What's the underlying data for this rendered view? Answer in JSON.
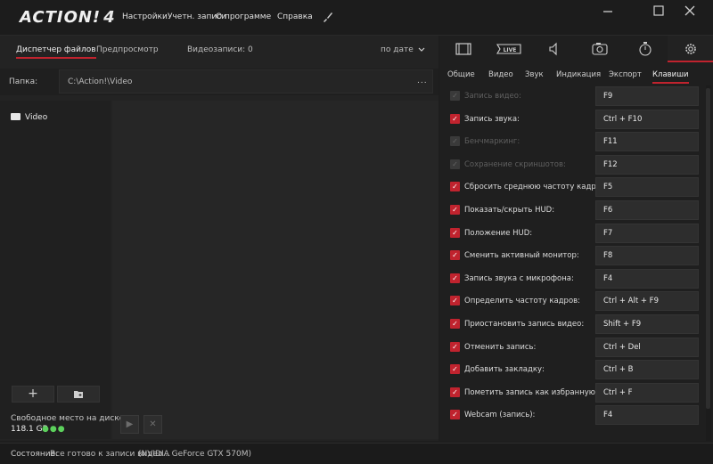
{
  "app": {
    "logo": "ACTION!",
    "logo_version": "4",
    "menu": [
      "Настройки",
      "Учетн. записи",
      "О программе",
      "Справка"
    ],
    "window_controls": [
      "minimize-icon",
      "maximize-icon",
      "close-icon"
    ]
  },
  "left": {
    "tabs": [
      "Диспетчер файлов",
      "Предпросмотр"
    ],
    "recordings_label": "Видеозаписи: 0",
    "sort_label": "по дате",
    "folder_label": "Папка:",
    "folder_path": "C:\\Action!\\Video",
    "folder_more": "...",
    "tree": [
      {
        "label": "Video"
      }
    ],
    "free_space_label": "Свободное место на диске",
    "free_space_value": "118.1 GB",
    "free_space_indicator": "●●●"
  },
  "status": {
    "label": "Состояние:",
    "text": "Все готово к записи видео...",
    "gpu": "(NVIDIA GeForce GTX 570M)"
  },
  "right": {
    "top_tabs": [
      "video-icon",
      "live-icon",
      "speaker-icon",
      "camera-icon",
      "stopwatch-icon",
      "gear-icon"
    ],
    "live_label": "LIVE",
    "sub_tabs": [
      "Общие",
      "Видео",
      "Звук",
      "Индикация",
      "Экспорт",
      "Клавиши"
    ],
    "active_sub_tab": "Клавиши",
    "hotkeys": [
      {
        "label": "Запись видео:",
        "key": "F9",
        "enabled": false
      },
      {
        "label": "Запись звука:",
        "key": "Ctrl + F10",
        "enabled": true
      },
      {
        "label": "Бенчмаркинг:",
        "key": "F11",
        "enabled": false
      },
      {
        "label": "Сохранение скриншотов:",
        "key": "F12",
        "enabled": false
      },
      {
        "label": "Сбросить среднюю частоту кадров:",
        "key": "F5",
        "enabled": true
      },
      {
        "label": "Показать/скрыть HUD:",
        "key": "F6",
        "enabled": true
      },
      {
        "label": "Положение HUD:",
        "key": "F7",
        "enabled": true
      },
      {
        "label": "Сменить активный монитор:",
        "key": "F8",
        "enabled": true
      },
      {
        "label": "Запись звука с микрофона:",
        "key": "F4",
        "enabled": true
      },
      {
        "label": "Определить частоту кадров:",
        "key": "Ctrl + Alt + F9",
        "enabled": true
      },
      {
        "label": "Приостановить запись видео:",
        "key": "Shift + F9",
        "enabled": true
      },
      {
        "label": "Отменить запись:",
        "key": "Ctrl + Del",
        "enabled": true
      },
      {
        "label": "Добавить закладку:",
        "key": "Ctrl + B",
        "enabled": true
      },
      {
        "label": "Пометить запись как избранную:",
        "key": "Ctrl + F",
        "enabled": true
      },
      {
        "label": "Webcam (запись):",
        "key": "F4",
        "enabled": true
      }
    ]
  },
  "colors": {
    "accent": "#c0232e",
    "free_space_ok": "#5cd15c"
  }
}
